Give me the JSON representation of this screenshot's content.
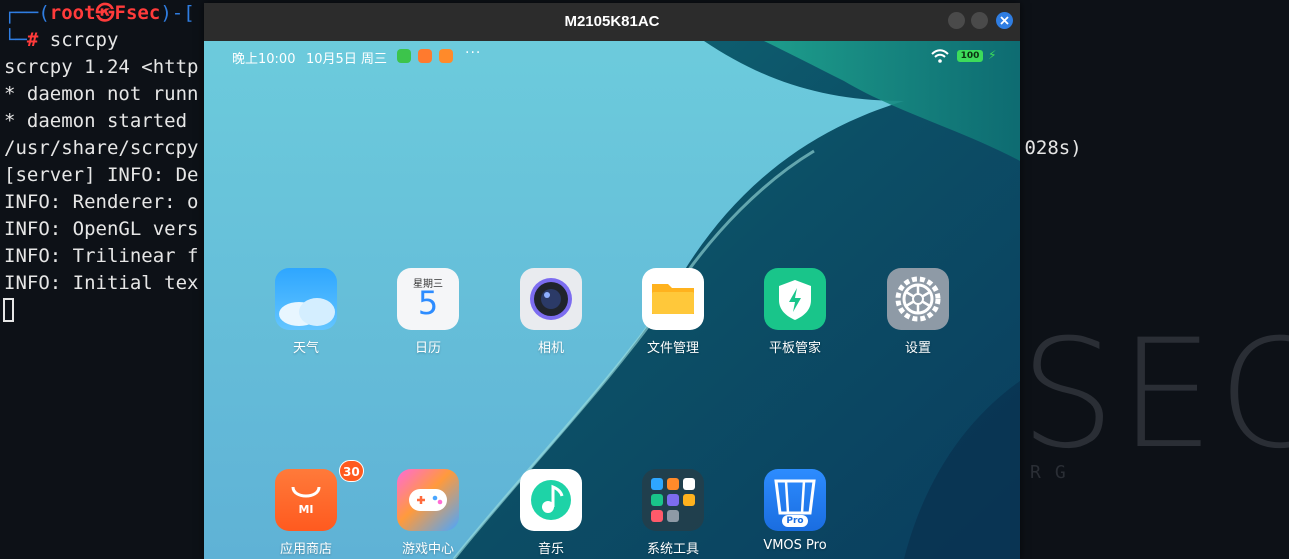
{
  "terminal": {
    "prompt": {
      "box_open": "┌──(",
      "user": "root",
      "at_icon": "㉿",
      "host": "Fsec",
      "box_close": ")-[",
      "hash_prefix": "└─",
      "hash": "#",
      "command": " scrcpy"
    },
    "lines": [
      "scrcpy 1.24 <http",
      "* daemon not runn",
      "* daemon started ",
      "/usr/share/scrcpy",
      "[server] INFO: De",
      "INFO: Renderer: o",
      "INFO: OpenGL vers",
      "INFO: Trilinear f",
      "INFO: Initial tex"
    ],
    "overflow_text": ".028s)",
    "watermark": "SEC",
    "watermark_sub": "RG"
  },
  "window": {
    "title": "M2105K81AC",
    "controls": [
      "minimize-button",
      "maximize-button",
      "close-button"
    ],
    "accent_color": "#2f7de1"
  },
  "device": {
    "status_bar": {
      "time": "晚上10:00",
      "date": "10月5日 周三",
      "overflow": "···",
      "battery": "100",
      "notification_colors": [
        "#3cc44b",
        "#ff7a2e",
        "#ff8a2a"
      ]
    },
    "apps": [
      {
        "label": "天气",
        "icon": "weather-icon"
      },
      {
        "label": "日历",
        "icon": "calendar-icon",
        "weekday": "星期三",
        "day": "5"
      },
      {
        "label": "相机",
        "icon": "camera-icon"
      },
      {
        "label": "文件管理",
        "icon": "folder-icon"
      },
      {
        "label": "平板管家",
        "icon": "security-shield-icon"
      },
      {
        "label": "设置",
        "icon": "settings-gear-icon"
      },
      {
        "label": "应用商店",
        "icon": "app-store-icon",
        "badge": "30"
      },
      {
        "label": "游戏中心",
        "icon": "game-controller-icon"
      },
      {
        "label": "音乐",
        "icon": "music-note-icon"
      },
      {
        "label": "系统工具",
        "icon": "folder-grid-icon"
      },
      {
        "label": "VMOS Pro",
        "icon": "vmos-icon",
        "sub": "Pro"
      }
    ]
  }
}
